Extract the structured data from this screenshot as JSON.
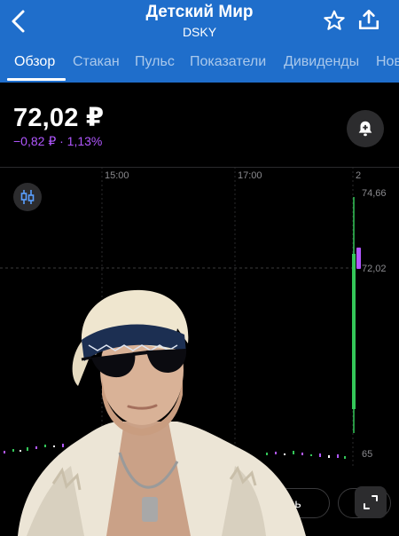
{
  "header": {
    "title": "Детский Мир",
    "ticker": "DSKY",
    "icons": {
      "back": "chevron-left-icon",
      "favorite": "star-icon",
      "share": "share-icon"
    },
    "background_color": "#1f6ecb"
  },
  "tabs": [
    {
      "label": "Обзор",
      "active": true
    },
    {
      "label": "Стакан",
      "active": false
    },
    {
      "label": "Пульс",
      "active": false
    },
    {
      "label": "Показатели",
      "active": false
    },
    {
      "label": "Дивиденды",
      "active": false
    },
    {
      "label": "Нов",
      "active": false
    }
  ],
  "quote": {
    "price": "72,02 ₽",
    "change": "−0,82 ₽ · 1,13%",
    "change_color": "#b157ff"
  },
  "alert_icon": "bell-plus-icon",
  "chart_type_icon": "candles-icon",
  "chart_data": {
    "type": "line",
    "x_tick_labels": [
      "15:00",
      "17:00",
      "2"
    ],
    "y_tick_labels": [
      "74,66",
      "72,02",
      "65"
    ],
    "up_color": "#34c759",
    "down_color": "#b157ff"
  },
  "period": {
    "selected_fragment": "ь"
  },
  "expand_icon": "expand-icon",
  "overlay": "meme-photo-sticker"
}
